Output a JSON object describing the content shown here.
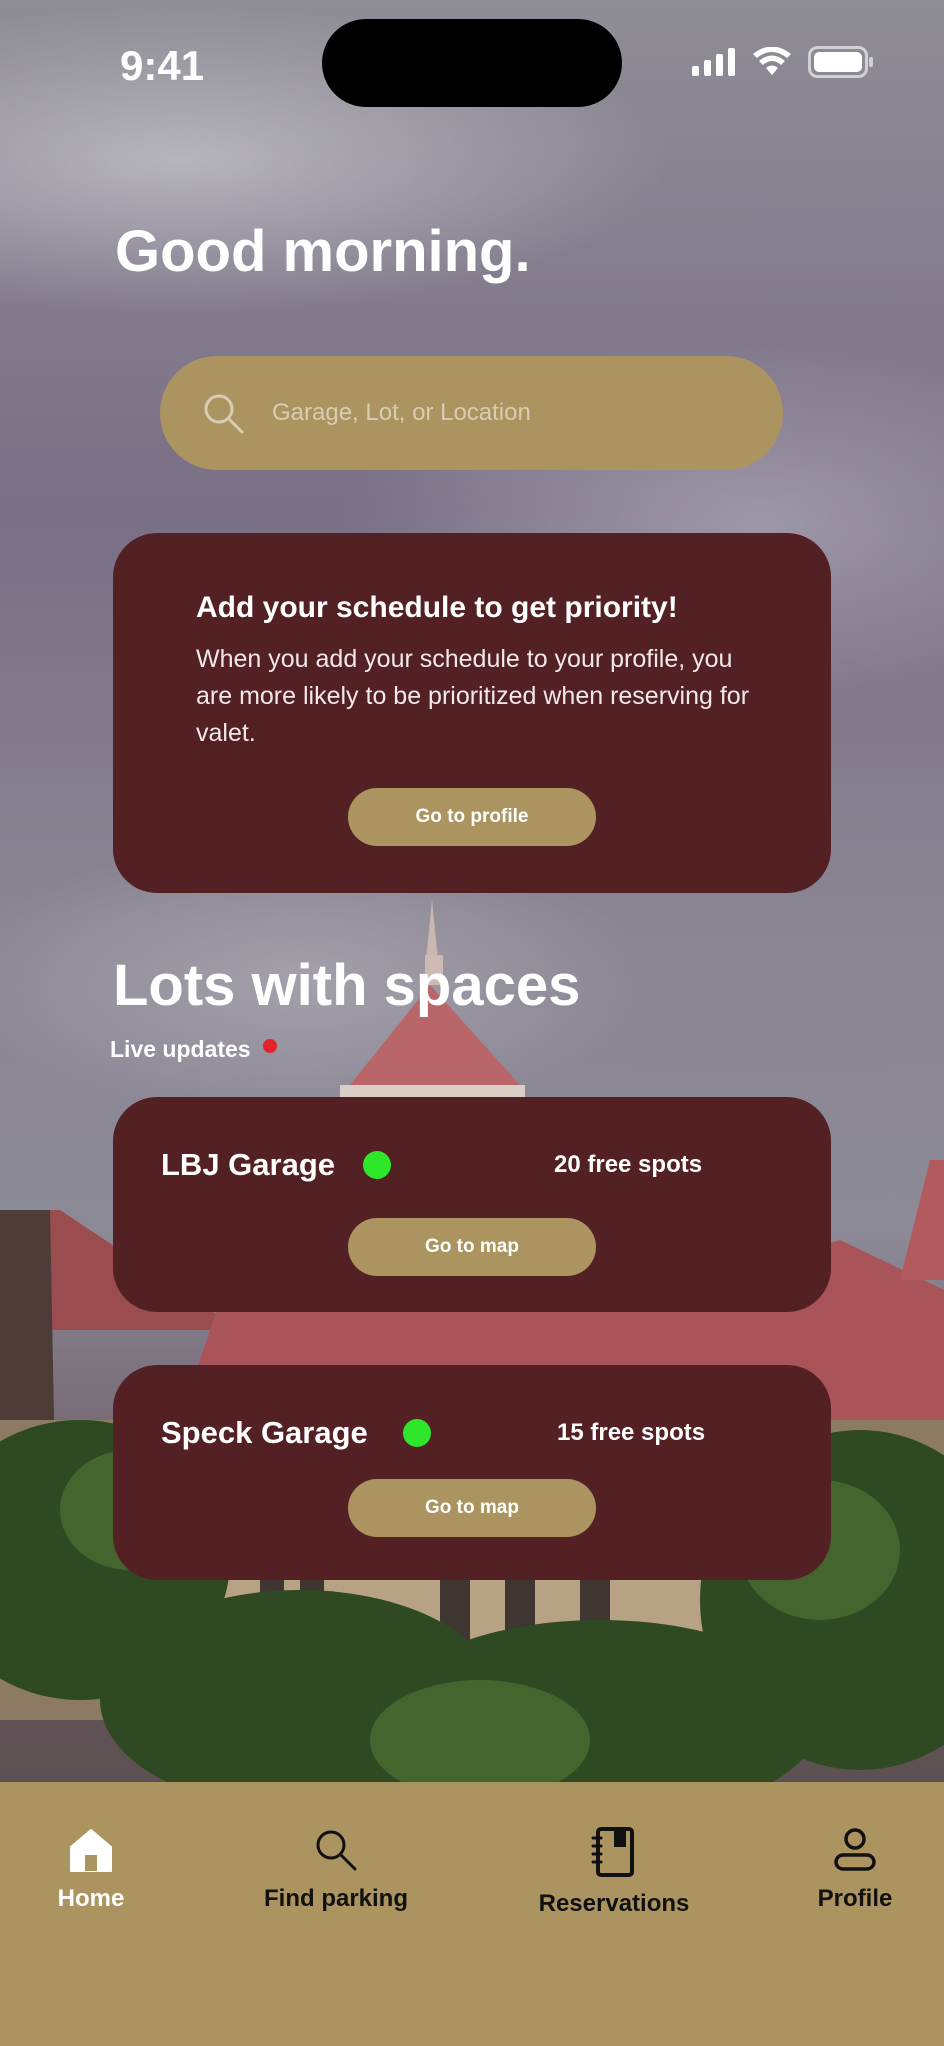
{
  "status_bar": {
    "time": "9:41"
  },
  "greeting": "Good morning.",
  "search": {
    "placeholder": "Garage, Lot, or Location"
  },
  "promo": {
    "title": "Add your schedule to get priority!",
    "body": "When you add your schedule to your profile, you are more likely to be prioritized when reserving for valet.",
    "button": "Go to profile"
  },
  "lots_section": {
    "title": "Lots with spaces",
    "live_label": "Live updates"
  },
  "lots": [
    {
      "name": "LBJ Garage",
      "spots": "20 free spots",
      "button": "Go to map"
    },
    {
      "name": "Speck Garage",
      "spots": "15 free spots",
      "button": "Go to map"
    }
  ],
  "tabbar": {
    "items": [
      {
        "label": "Home",
        "icon": "home-icon"
      },
      {
        "label": "Find parking",
        "icon": "search-icon"
      },
      {
        "label": "Reservations",
        "icon": "notebook-icon"
      },
      {
        "label": "Profile",
        "icon": "person-icon"
      }
    ]
  },
  "colors": {
    "accent": "#ac9460",
    "card": "#532024",
    "available": "#2ee62a",
    "live": "#e0242b"
  }
}
